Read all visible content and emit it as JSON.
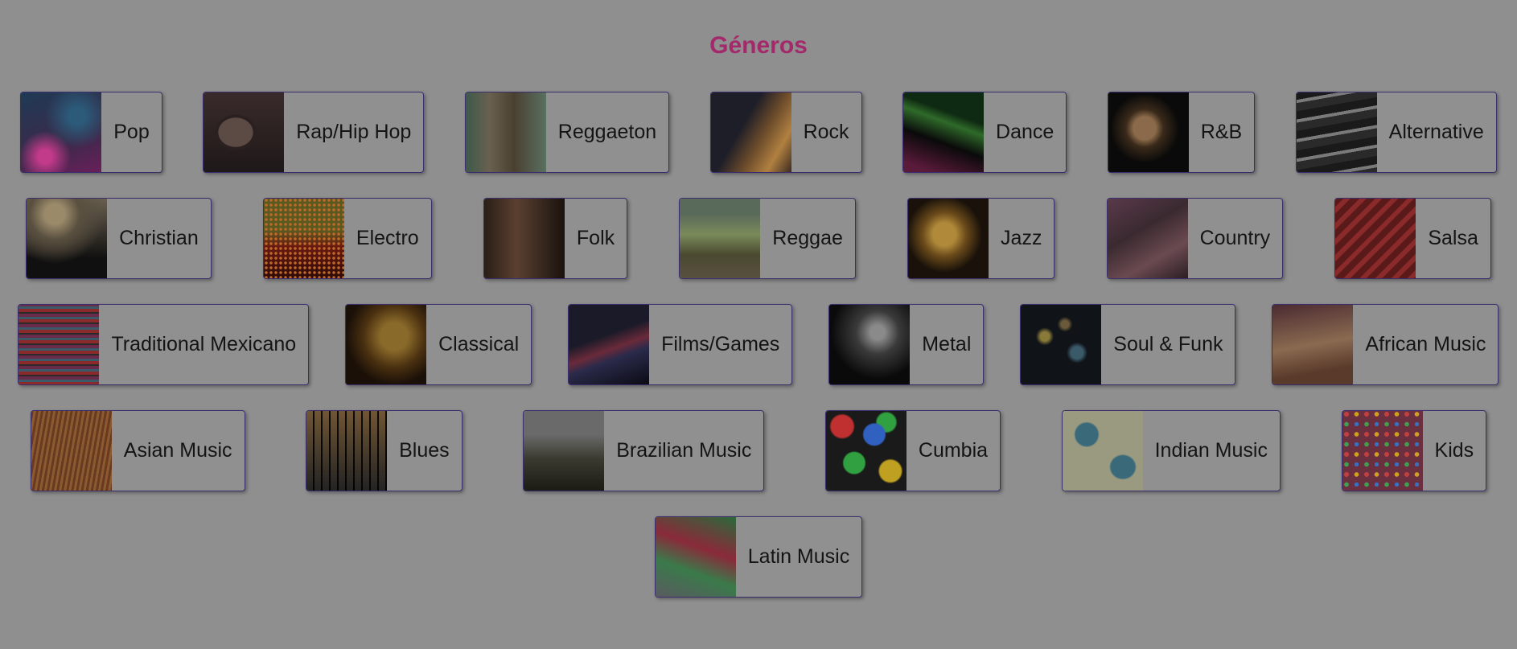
{
  "page": {
    "title": "Géneros"
  },
  "genres": {
    "row1": [
      {
        "label": "Pop",
        "thumb_icon": "concert-crowd-image"
      },
      {
        "label": "Rap/Hip Hop",
        "thumb_icon": "turntable-image"
      },
      {
        "label": "Reggaeton",
        "thumb_icon": "dancers-image"
      },
      {
        "label": "Rock",
        "thumb_icon": "guitar-image"
      },
      {
        "label": "Dance",
        "thumb_icon": "laser-lights-image"
      },
      {
        "label": "R&B",
        "thumb_icon": "microphone-image"
      },
      {
        "label": "Alternative",
        "thumb_icon": "abstract-lines-image"
      }
    ],
    "row2": [
      {
        "label": "Christian",
        "thumb_icon": "raised-arms-silhouette-image"
      },
      {
        "label": "Electro",
        "thumb_icon": "led-panel-image"
      },
      {
        "label": "Folk",
        "thumb_icon": "acoustic-guitar-tree-image"
      },
      {
        "label": "Reggae",
        "thumb_icon": "palm-beach-image"
      },
      {
        "label": "Jazz",
        "thumb_icon": "saxophone-image"
      },
      {
        "label": "Country",
        "thumb_icon": "cowboy-boots-image"
      },
      {
        "label": "Salsa",
        "thumb_icon": "red-pattern-image"
      }
    ],
    "row3": [
      {
        "label": "Traditional Mexicano",
        "thumb_icon": "woven-textile-image"
      },
      {
        "label": "Classical",
        "thumb_icon": "opera-house-image"
      },
      {
        "label": "Films/Games",
        "thumb_icon": "light-trails-image"
      },
      {
        "label": "Metal",
        "thumb_icon": "headbanger-image"
      },
      {
        "label": "Soul & Funk",
        "thumb_icon": "bokeh-lights-image"
      },
      {
        "label": "African Music",
        "thumb_icon": "drums-image"
      }
    ],
    "row4": [
      {
        "label": "Asian Music",
        "thumb_icon": "zither-image"
      },
      {
        "label": "Blues",
        "thumb_icon": "piano-keys-image"
      },
      {
        "label": "Brazilian Music",
        "thumb_icon": "trumpet-player-image"
      },
      {
        "label": "Cumbia",
        "thumb_icon": "colorful-flowers-image"
      },
      {
        "label": "Indian Music",
        "thumb_icon": "elephant-pattern-image"
      },
      {
        "label": "Kids",
        "thumb_icon": "candy-balls-image"
      }
    ],
    "row5": [
      {
        "label": "Latin Music",
        "thumb_icon": "folk-dress-image"
      }
    ]
  }
}
